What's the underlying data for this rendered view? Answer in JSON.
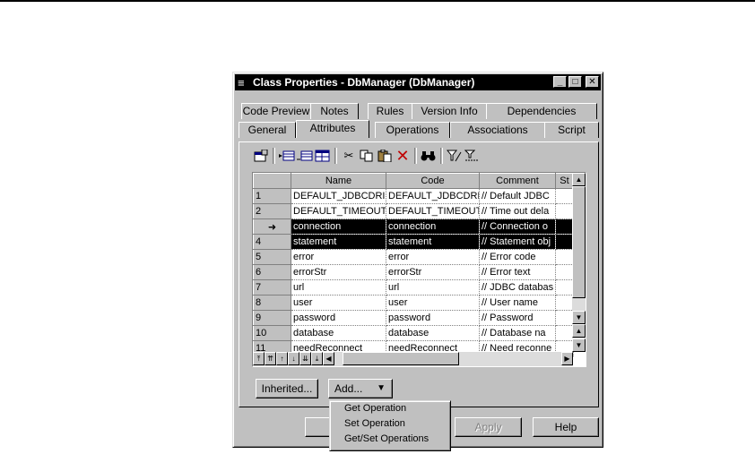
{
  "window": {
    "title": "Class Properties - DbManager (DbManager)",
    "controls": {
      "minimize": "_",
      "maximize": "□",
      "close": "✕"
    }
  },
  "tabs": {
    "row_back": [
      "Code Preview",
      "Notes",
      "Rules",
      "Version Info",
      "Dependencies"
    ],
    "row_front": [
      "General",
      "Attributes",
      "Operations",
      "Associations",
      "Script"
    ],
    "active": "Attributes"
  },
  "toolbar": {
    "icons": [
      "properties-icon",
      "insert-row-icon",
      "add-row-icon",
      "add-attributes-icon",
      "cut-icon",
      "copy-icon",
      "paste-icon",
      "delete-icon",
      "find-icon",
      "filter-icon",
      "customize-columns-icon"
    ]
  },
  "grid": {
    "columns": [
      "Name",
      "Code",
      "Comment",
      "St"
    ],
    "rows": [
      {
        "num": "1",
        "name": "DEFAULT_JDBCDRI",
        "code": "DEFAULT_JDBCDRI",
        "comment": "// Default JDBC"
      },
      {
        "num": "2",
        "name": "DEFAULT_TIMEOUT",
        "code": "DEFAULT_TIMEOUT",
        "comment": "// Time out dela"
      },
      {
        "num": "➜",
        "name": "connection",
        "code": "connection",
        "comment": "// Connection o"
      },
      {
        "num": "4",
        "name": "statement",
        "code": "statement",
        "comment": "// Statement obj"
      },
      {
        "num": "5",
        "name": "error",
        "code": "error",
        "comment": "// Error code"
      },
      {
        "num": "6",
        "name": "errorStr",
        "code": "errorStr",
        "comment": "// Error text"
      },
      {
        "num": "7",
        "name": "url",
        "code": "url",
        "comment": "// JDBC databas"
      },
      {
        "num": "8",
        "name": "user",
        "code": "user",
        "comment": "// User name"
      },
      {
        "num": "9",
        "name": "password",
        "code": "password",
        "comment": "// Password"
      },
      {
        "num": "10",
        "name": "database",
        "code": "database",
        "comment": "// Database na"
      },
      {
        "num": "11",
        "name": "needReconnect",
        "code": "needReconnect",
        "comment": "// Need reconne"
      }
    ]
  },
  "buttons": {
    "inherited": "Inherited...",
    "add": "Add...",
    "apply": "Apply",
    "help": "Help"
  },
  "add_menu": {
    "items": [
      "Get Operation",
      "Set Operation",
      "Get/Set Operations"
    ]
  }
}
